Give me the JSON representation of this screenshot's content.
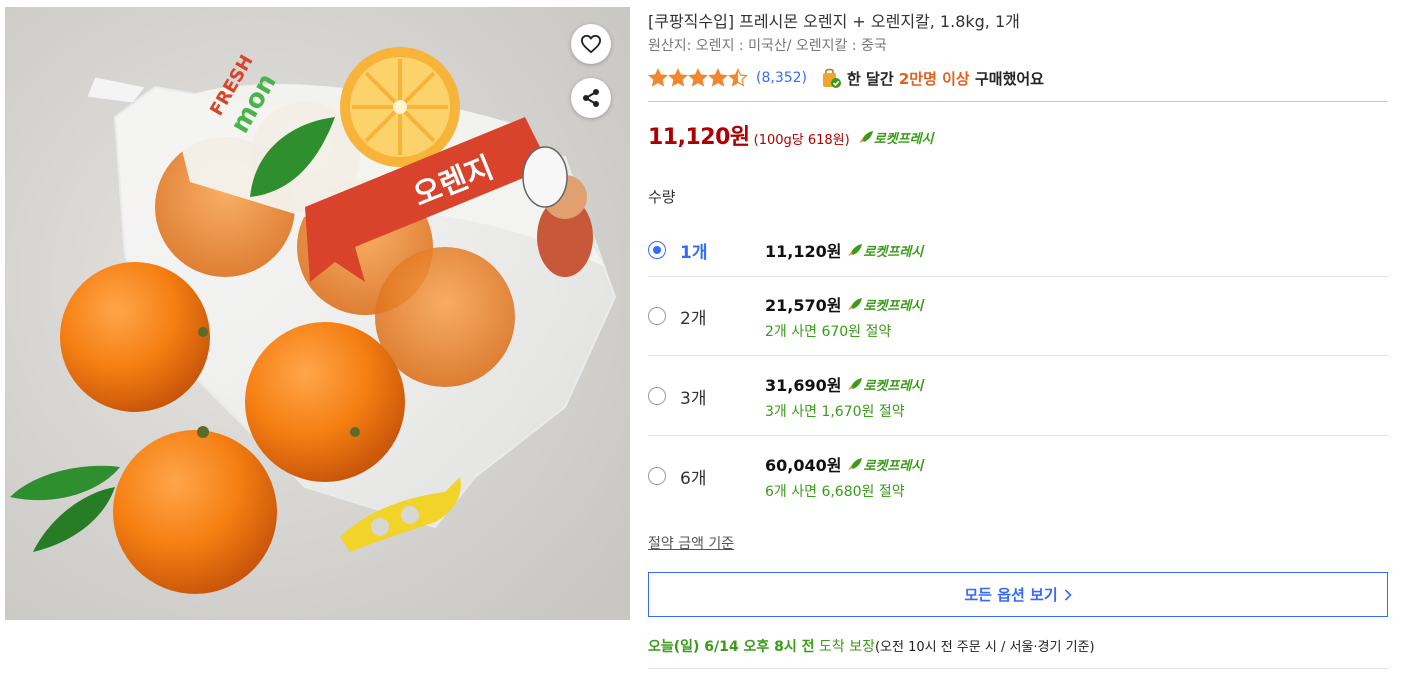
{
  "product": {
    "title": "[쿠팡직수입] 프레시몬 오렌지 + 오렌지칼, 1.8kg, 1개",
    "origin": "원산지: 오렌지 : 미국산/ 오렌지칼 : 중국",
    "image_alt": "오렌지 상품 이미지",
    "package_label": "오렌지",
    "brand_logo_top": "FRESH",
    "brand_logo_bottom": "mon"
  },
  "rating": {
    "stars": 4.5,
    "review_count": "(8,352)",
    "bought_prefix": "한 달간 ",
    "bought_highlight": "2만명 이상",
    "bought_suffix": " 구매했어요"
  },
  "price": {
    "main": "11,120원",
    "unit": "(100g당 618원)",
    "rocket_label": "로켓프레시"
  },
  "quantity": {
    "label": "수량",
    "options": [
      {
        "qty": "1개",
        "price": "11,120원",
        "rocket": "로켓프레시",
        "saving": "",
        "selected": true
      },
      {
        "qty": "2개",
        "price": "21,570원",
        "rocket": "로켓프레시",
        "saving": "2개 사면 670원 절약",
        "selected": false
      },
      {
        "qty": "3개",
        "price": "31,690원",
        "rocket": "로켓프레시",
        "saving": "3개 사면 1,670원 절약",
        "selected": false
      },
      {
        "qty": "6개",
        "price": "60,040원",
        "rocket": "로켓프레시",
        "saving": "6개 사면 6,680원 절약",
        "selected": false
      }
    ],
    "save_basis": "절약 금액 기준"
  },
  "all_options_label": "모든 옵션 보기",
  "delivery": {
    "day": "오늘(일) 6/14 오후 8시 전",
    "arrive": " 도착 보장",
    "cutoff": "(오전 10시 전 주문 시 / 서울·경기 기준)"
  },
  "colors": {
    "price_red": "#ae0000",
    "link_blue": "#346aff",
    "rocket_green": "#3a9b18",
    "star_orange": "#f0872f",
    "highlight_orange": "#e2601b"
  },
  "icons": {
    "heart": "heart-icon",
    "share": "share-icon",
    "star": "star-icon",
    "bag": "shopping-bag-check-icon",
    "rocket": "rocket-icon",
    "chevron": "chevron-right-icon"
  }
}
